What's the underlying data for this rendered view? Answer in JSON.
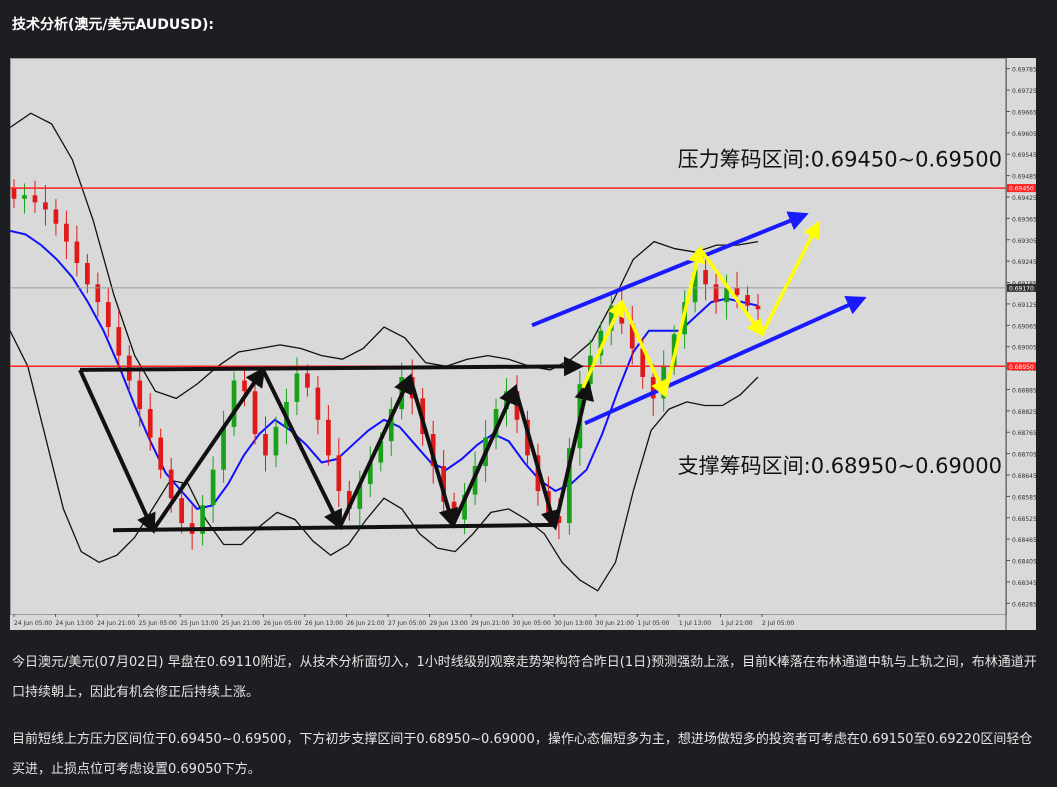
{
  "page": {
    "title": "技术分析(澳元/美元AUDUSD):",
    "paragraph1": "今日澳元/美元(07月02日) 早盘在0.69110附近，从技术分析面切入，1小时线级别观察走势架构符合昨日(1日)预测强劲上涨，目前K棒落在布林通道中轨与上轨之间，布林通道开口持续朝上，因此有机会修正后持续上涨。",
    "paragraph2": "目前短线上方压力区间位于0.69450~0.69500，下方初步支撑区间于0.68950~0.69000，操作心态偏短多为主，想进场做短多的投资者可考虑在0.69150至0.69220区间轻仓买进，止损点位可考虑设置0.69050下方。"
  },
  "chart_data": {
    "type": "line",
    "instrument": "AUDUSD",
    "ylim": [
      0.68255,
      0.69815
    ],
    "y_ticks": [
      0.69785,
      0.69725,
      0.69665,
      0.69605,
      0.69545,
      0.69485,
      0.69425,
      0.69365,
      0.69305,
      0.69245,
      0.69185,
      0.69125,
      0.69065,
      0.69005,
      0.68945,
      0.68885,
      0.68825,
      0.68765,
      0.68705,
      0.68645,
      0.68585,
      0.68525,
      0.68465,
      0.68405,
      0.68345,
      0.68285
    ],
    "x_labels": [
      "24 Jun 05:00",
      "24 Jun 13:00",
      "24 Jun 21:00",
      "25 Jun 05:00",
      "25 Jun 13:00",
      "25 Jun 21:00",
      "26 Jun 05:00",
      "26 Jun 13:00",
      "26 Jun 21:00",
      "27 Jun 05:00",
      "29 Jun 13:00",
      "29 Jun 21:00",
      "30 Jun 05:00",
      "30 Jun 13:00",
      "30 Jun 21:00",
      "1 Jul 05:00",
      "1 Jul 13:00",
      "1 Jul 21:00",
      "2 Jul 05:00"
    ],
    "price_labels": [
      {
        "value": 0.6945,
        "text": "0.69450",
        "color": "#ff2020"
      },
      {
        "value": 0.6917,
        "text": "0.69170",
        "color": "#333333"
      },
      {
        "value": 0.6895,
        "text": "0.68950",
        "color": "#ff2020"
      }
    ],
    "horizontal_levels": [
      {
        "value": 0.6945,
        "color": "#ff2020"
      },
      {
        "value": 0.6895,
        "color": "#ff2020"
      },
      {
        "value": 0.6917,
        "color": "#9a9a9a"
      }
    ],
    "annotations": [
      {
        "text": "压力筹码区间:0.69450~0.69500",
        "anchor_value": 0.6951
      },
      {
        "text": "支撑筹码区间:0.68950~0.69000",
        "anchor_value": 0.6865
      }
    ],
    "close": [
      0.6942,
      0.6943,
      0.6941,
      0.6939,
      0.6935,
      0.693,
      0.6924,
      0.6918,
      0.6913,
      0.6906,
      0.6898,
      0.6891,
      0.6883,
      0.6875,
      0.6866,
      0.6858,
      0.6851,
      0.6848,
      0.6856,
      0.6866,
      0.6878,
      0.6891,
      0.6888,
      0.6876,
      0.687,
      0.6878,
      0.6885,
      0.6893,
      0.6889,
      0.688,
      0.687,
      0.686,
      0.6855,
      0.6862,
      0.6868,
      0.6874,
      0.6883,
      0.6892,
      0.6886,
      0.6876,
      0.6867,
      0.6857,
      0.6852,
      0.6859,
      0.6867,
      0.6875,
      0.6883,
      0.6888,
      0.688,
      0.687,
      0.686,
      0.6853,
      0.6851,
      0.6872,
      0.689,
      0.6898,
      0.6905,
      0.6912,
      0.6907,
      0.69,
      0.6892,
      0.6886,
      0.6895,
      0.6904,
      0.6913,
      0.6922,
      0.6918,
      0.6913,
      0.6917,
      0.6915,
      0.6912,
      0.6911
    ],
    "middle_band": [
      0.6933,
      0.6932,
      0.6929,
      0.6925,
      0.692,
      0.6913,
      0.6905,
      0.6895,
      0.6884,
      0.6874,
      0.6865,
      0.686,
      0.6855,
      0.6856,
      0.6862,
      0.687,
      0.6876,
      0.688,
      0.6877,
      0.6873,
      0.6868,
      0.6869,
      0.6873,
      0.6877,
      0.688,
      0.6878,
      0.6873,
      0.6868,
      0.6866,
      0.6869,
      0.6873,
      0.6876,
      0.6874,
      0.6868,
      0.6863,
      0.686,
      0.6862,
      0.6866,
      0.6876,
      0.6888,
      0.6899,
      0.6905,
      0.6905,
      0.6905,
      0.6909,
      0.6913,
      0.6914,
      0.6913,
      0.6912
    ],
    "upper_band": [
      0.6962,
      0.6966,
      0.6963,
      0.6953,
      0.6936,
      0.6915,
      0.6898,
      0.6888,
      0.6886,
      0.689,
      0.6895,
      0.6899,
      0.69,
      0.6901,
      0.69,
      0.6898,
      0.6897,
      0.69,
      0.6906,
      0.6903,
      0.6896,
      0.6895,
      0.6897,
      0.6898,
      0.6897,
      0.6895,
      0.6894,
      0.6897,
      0.6902,
      0.6913,
      0.6925,
      0.693,
      0.6928,
      0.6927,
      0.6929,
      0.6929,
      0.693
    ],
    "lower_band": [
      0.6905,
      0.6895,
      0.6875,
      0.6855,
      0.6843,
      0.684,
      0.6842,
      0.6847,
      0.6855,
      0.6863,
      0.6862,
      0.6852,
      0.6845,
      0.6845,
      0.685,
      0.6854,
      0.6852,
      0.6846,
      0.6842,
      0.6845,
      0.6852,
      0.6858,
      0.6855,
      0.6848,
      0.6844,
      0.6843,
      0.6848,
      0.6854,
      0.6855,
      0.6852,
      0.6848,
      0.684,
      0.6835,
      0.6832,
      0.684,
      0.686,
      0.6877,
      0.6883,
      0.6885,
      0.6884,
      0.6884,
      0.6887,
      0.6892
    ]
  }
}
